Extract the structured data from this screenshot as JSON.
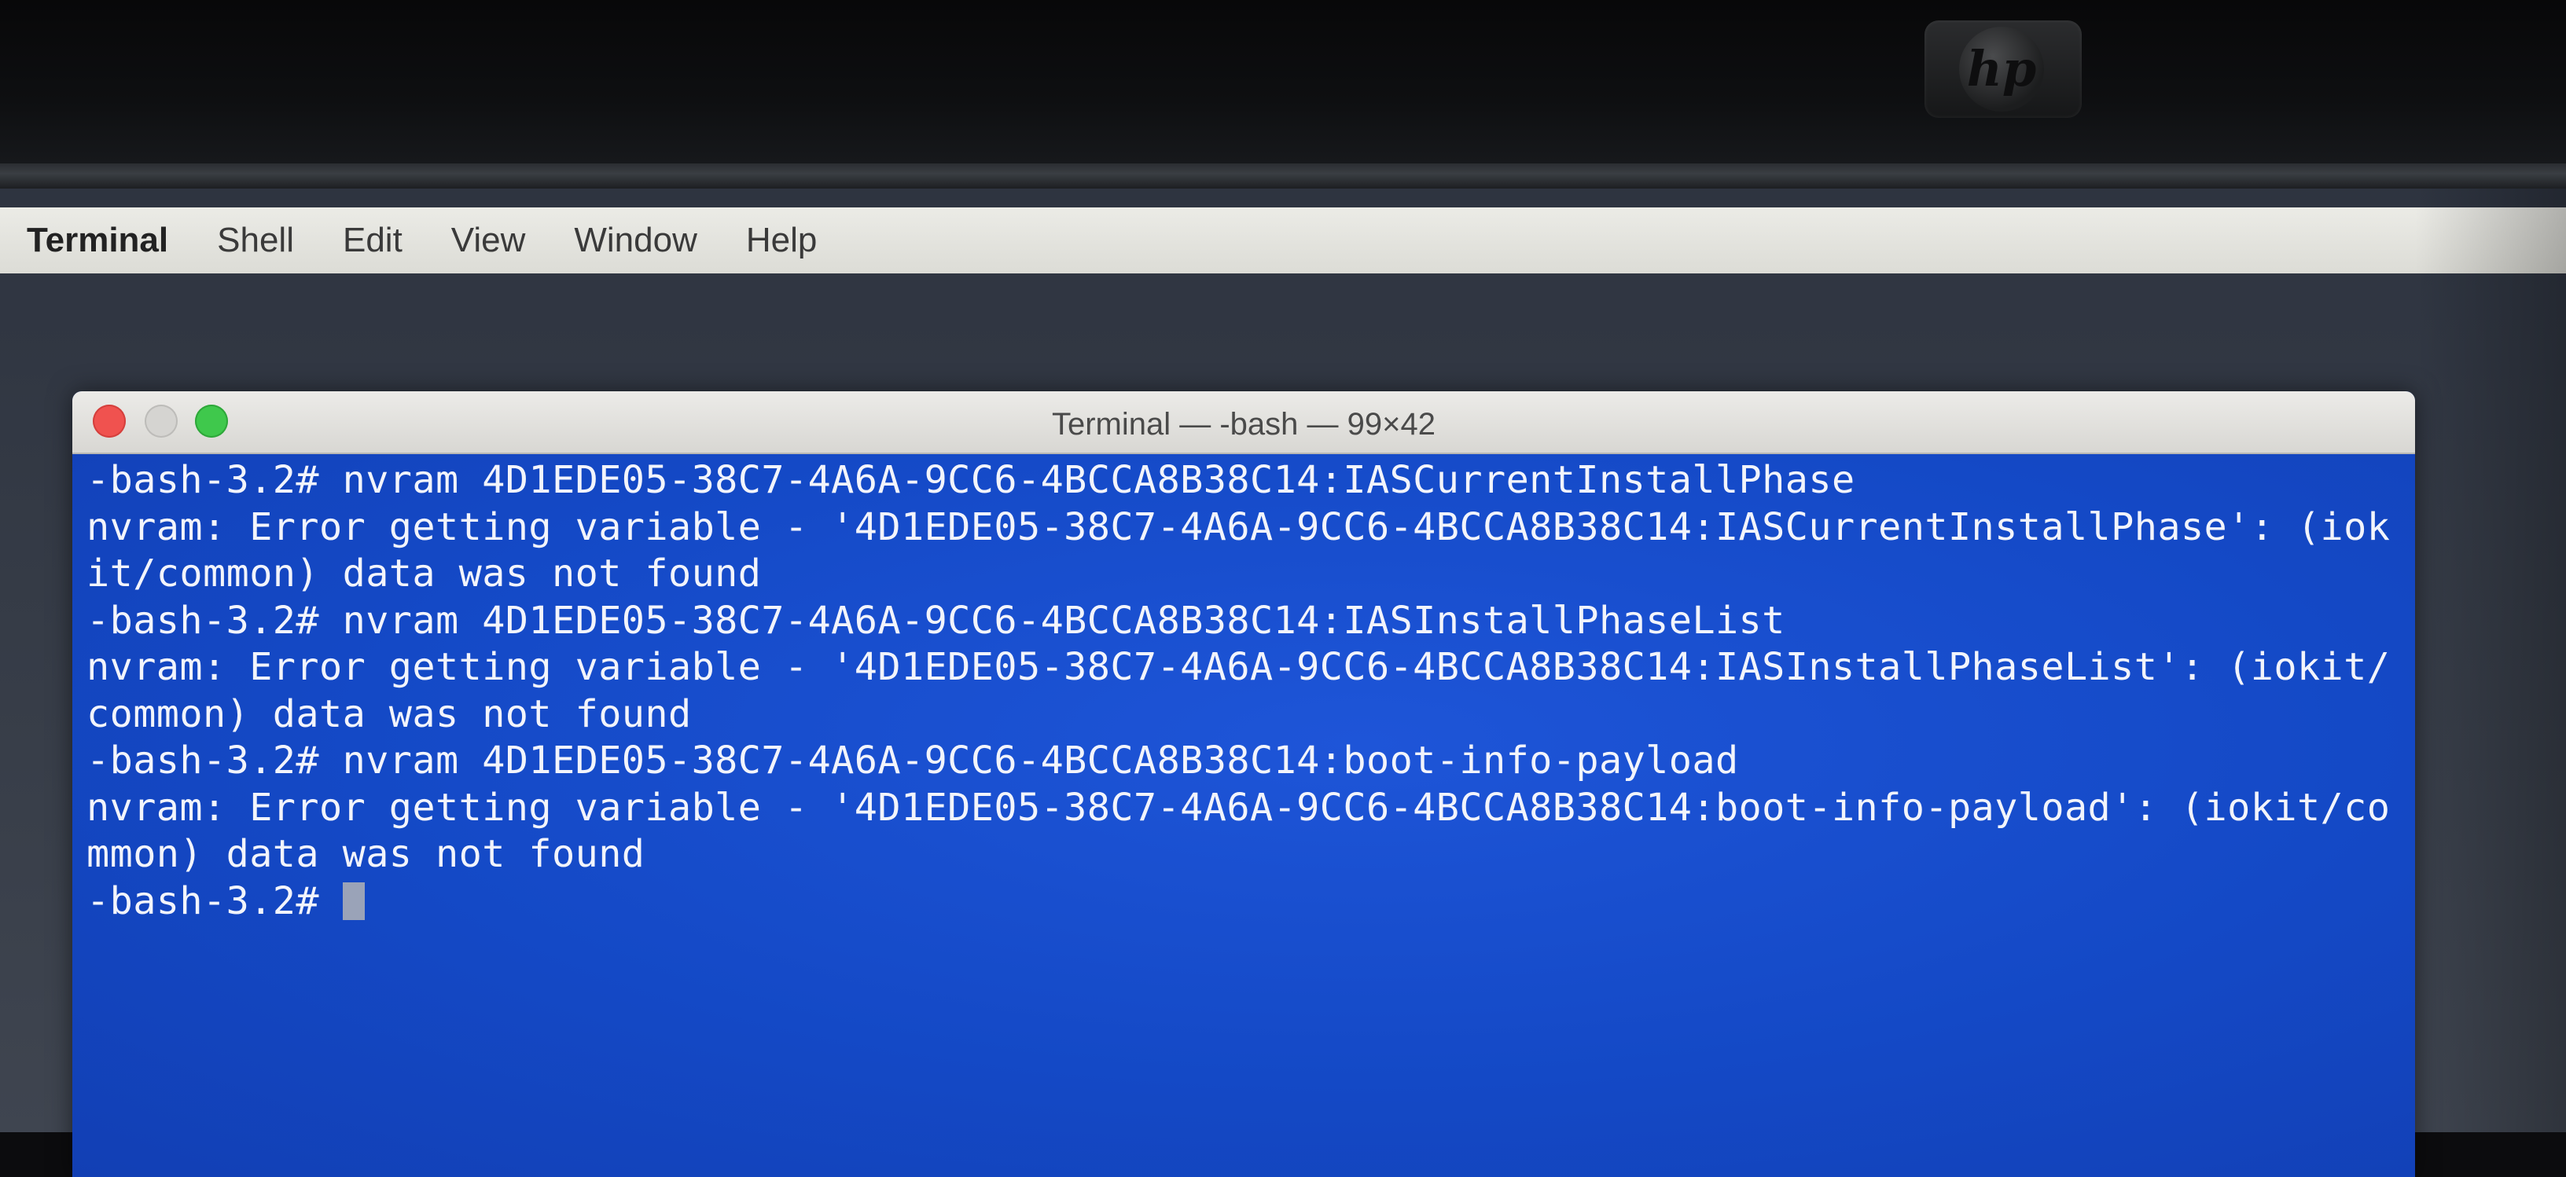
{
  "menubar": {
    "items": [
      "Terminal",
      "Shell",
      "Edit",
      "View",
      "Window",
      "Help"
    ]
  },
  "window": {
    "title": "Terminal — -bash — 99×42"
  },
  "terminal": {
    "lines": [
      "-bash-3.2# nvram 4D1EDE05-38C7-4A6A-9CC6-4BCCA8B38C14:IASCurrentInstallPhase",
      "nvram: Error getting variable - '4D1EDE05-38C7-4A6A-9CC6-4BCCA8B38C14:IASCurrentInstallPhase': (iok",
      "it/common) data was not found",
      "-bash-3.2# nvram 4D1EDE05-38C7-4A6A-9CC6-4BCCA8B38C14:IASInstallPhaseList",
      "nvram: Error getting variable - '4D1EDE05-38C7-4A6A-9CC6-4BCCA8B38C14:IASInstallPhaseList': (iokit/",
      "common) data was not found",
      "-bash-3.2# nvram 4D1EDE05-38C7-4A6A-9CC6-4BCCA8B38C14:boot-info-payload",
      "nvram: Error getting variable - '4D1EDE05-38C7-4A6A-9CC6-4BCCA8B38C14:boot-info-payload': (iokit/co",
      "mmon) data was not found"
    ],
    "prompt": "-bash-3.2# "
  },
  "colors": {
    "terminal_background": "#1749c8",
    "terminal_text": "#f2f4fb",
    "close_button": "#f0524f",
    "zoom_button": "#3fc84c"
  },
  "bezel": {
    "logo_text": "hp"
  }
}
